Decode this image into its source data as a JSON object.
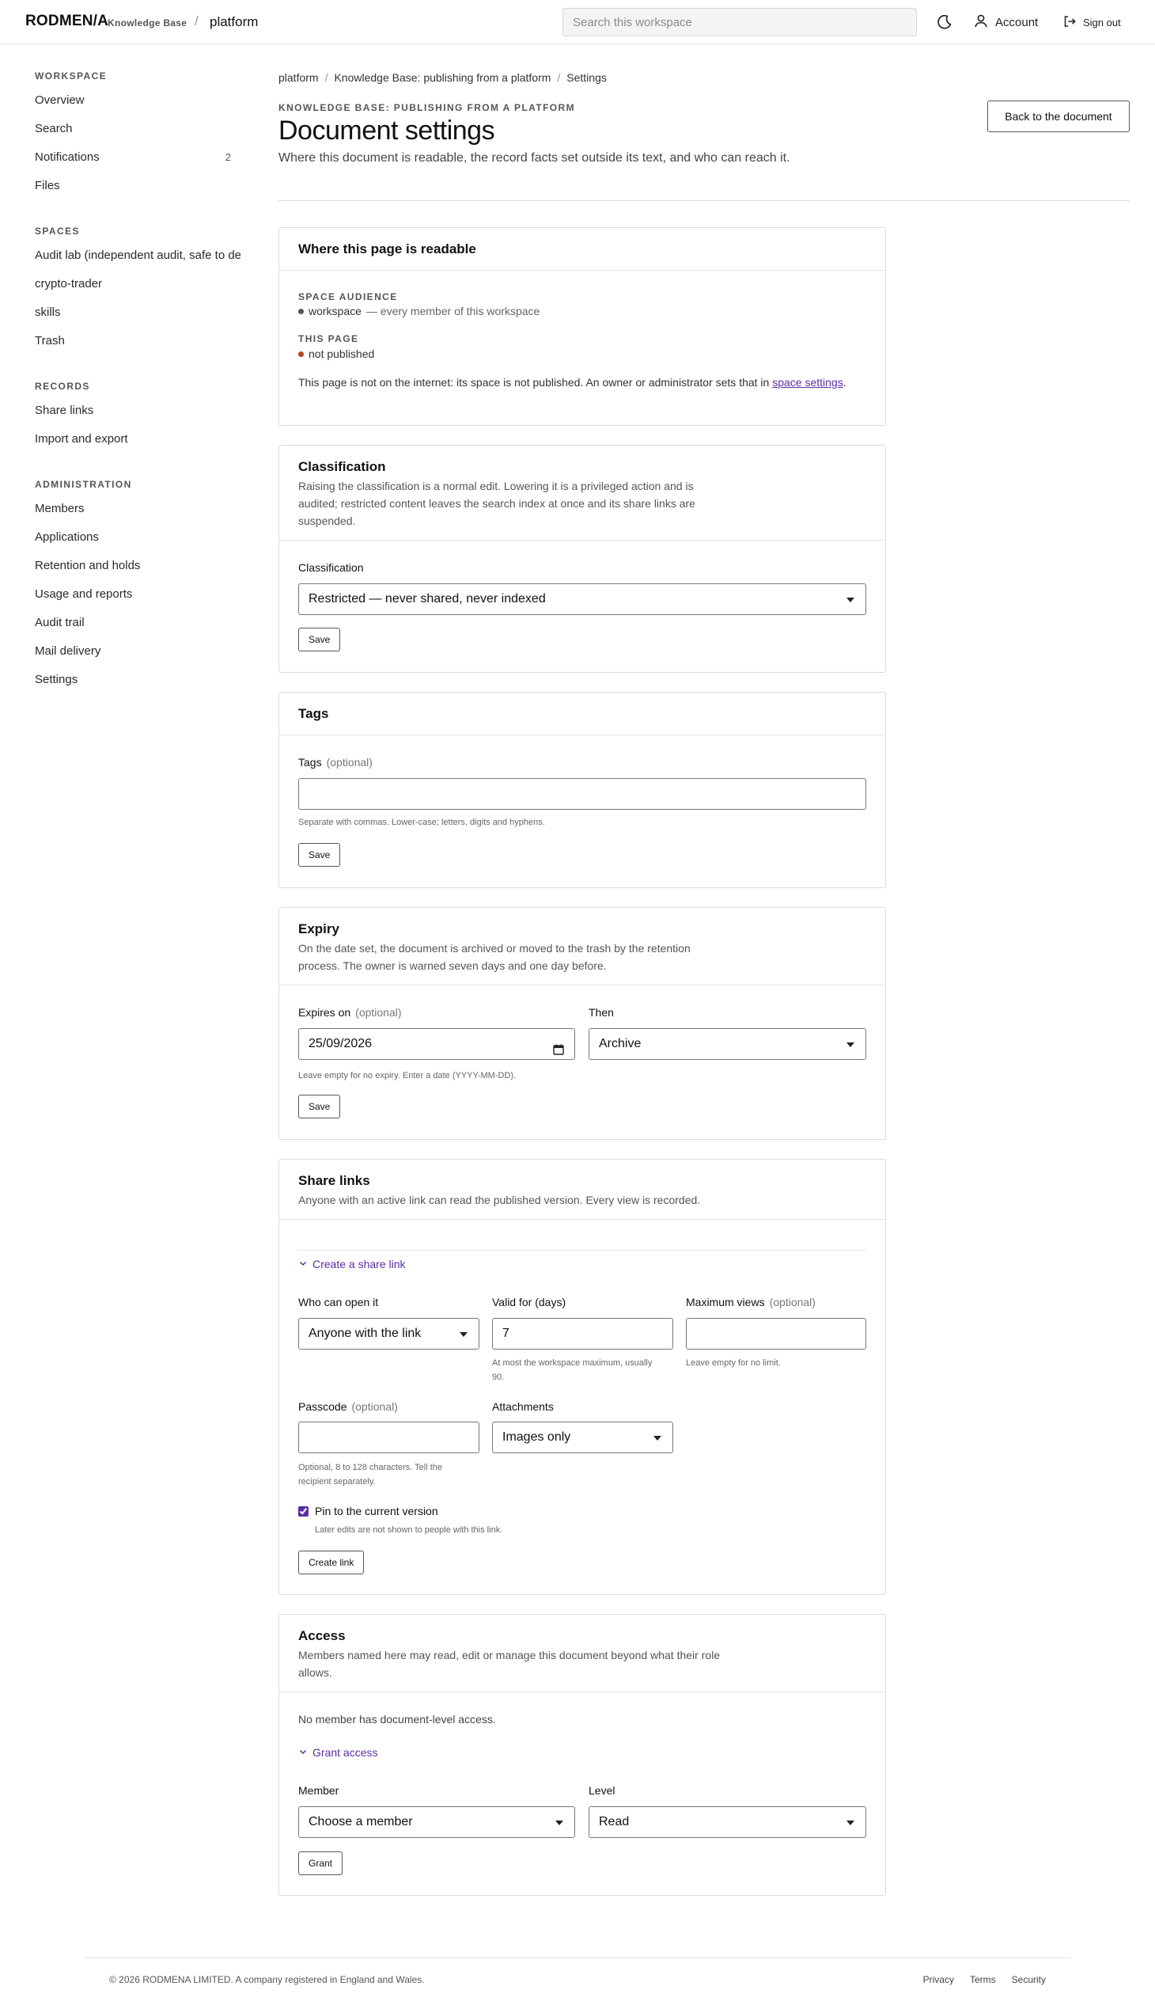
{
  "brand": {
    "name": "RODMEN/A",
    "product": "Knowledge Base",
    "separator": "/",
    "workspace": "platform"
  },
  "topbar": {
    "search_placeholder": "Search this workspace",
    "account_label": "Account",
    "signout_label": "Sign out",
    "icons": [
      "moon-icon",
      "user-icon",
      "sign-out-icon"
    ]
  },
  "sidebar": {
    "groups": [
      {
        "heading": "WORKSPACE",
        "items": [
          {
            "label": "Overview"
          },
          {
            "label": "Search"
          },
          {
            "label": "Notifications",
            "count": "2"
          },
          {
            "label": "Files"
          }
        ]
      },
      {
        "heading": "SPACES",
        "items": [
          {
            "label": "Audit lab (independent audit, safe to de"
          },
          {
            "label": "crypto-trader"
          },
          {
            "label": "skills"
          },
          {
            "label": "Trash"
          }
        ]
      },
      {
        "heading": "RECORDS",
        "items": [
          {
            "label": "Share links"
          },
          {
            "label": "Import and export"
          }
        ]
      },
      {
        "heading": "ADMINISTRATION",
        "items": [
          {
            "label": "Members"
          },
          {
            "label": "Applications"
          },
          {
            "label": "Retention and holds"
          },
          {
            "label": "Usage and reports"
          },
          {
            "label": "Audit trail"
          },
          {
            "label": "Mail delivery"
          },
          {
            "label": "Settings"
          }
        ]
      }
    ]
  },
  "breadcrumb": {
    "items": [
      "platform",
      "Knowledge Base: publishing from a platform",
      "Settings"
    ],
    "separator": "/"
  },
  "header": {
    "eyebrow": "KNOWLEDGE BASE: PUBLISHING FROM A PLATFORM",
    "title": "Document settings",
    "lede": "Where this document is readable, the record facts set outside its text, and who can reach it.",
    "back_button": "Back to the document"
  },
  "readable": {
    "title": "Where this page is readable",
    "audience_heading": "SPACE AUDIENCE",
    "audience_value": "workspace",
    "audience_note": "— every member of this workspace",
    "audience_dot_color": "#555555",
    "page_heading": "THIS PAGE",
    "page_value": "not published",
    "page_dot_color": "#b5421f",
    "note_text": "This page is not on the internet: its space is not published. An owner or administrator sets that in",
    "note_link": "space settings",
    "note_end": "."
  },
  "classification": {
    "title": "Classification",
    "desc": "Raising the classification is a normal edit. Lowering it is a privileged action and is audited; restricted content leaves the search index at once and its share links are suspended.",
    "label": "Classification",
    "selected": "Restricted — never shared, never indexed",
    "save": "Save"
  },
  "tags": {
    "title": "Tags",
    "label": "Tags",
    "optional": "(optional)",
    "value": "",
    "hint": "Separate with commas. Lower-case; letters, digits and hyphens.",
    "save": "Save"
  },
  "expiry": {
    "title": "Expiry",
    "desc": "On the date set, the document is archived or moved to the trash by the retention process. The owner is warned seven days and one day before.",
    "date_label": "Expires on",
    "optional": "(optional)",
    "date_value": "25/09/2026",
    "then_label": "Then",
    "then_selected": "Archive",
    "hint": "Leave empty for no expiry. Enter a date (YYYY-MM-DD).",
    "save": "Save"
  },
  "share": {
    "title": "Share links",
    "desc": "Anyone with an active link can read the published version. Every view is recorded.",
    "create_toggle": "Create a share link",
    "who_label": "Who can open it",
    "who_selected": "Anyone with the link",
    "valid_label": "Valid for (days)",
    "valid_value": "7",
    "valid_hint": "At most the workspace maximum, usually 90.",
    "maxviews_label": "Maximum views",
    "optional": "(optional)",
    "maxviews_value": "",
    "maxviews_hint": "Leave empty for no limit.",
    "passcode_label": "Passcode",
    "passcode_value": "",
    "passcode_hint": "Optional, 8 to 128 characters. Tell the recipient separately.",
    "attachments_label": "Attachments",
    "attachments_selected": "Images only",
    "pin_label": "Pin to the current version",
    "pin_checked": true,
    "pin_hint": "Later edits are not shown to people with this link.",
    "create_button": "Create link"
  },
  "access": {
    "title": "Access",
    "desc": "Members named here may read, edit or manage this document beyond what their role allows.",
    "empty": "No member has document-level access.",
    "grant_toggle": "Grant access",
    "member_label": "Member",
    "member_selected": "Choose a member",
    "level_label": "Level",
    "level_selected": "Read",
    "grant_button": "Grant"
  },
  "footer": {
    "text": "© 2026 RODMENA LIMITED. A company registered in England and Wales.",
    "links": [
      "Privacy",
      "Terms",
      "Security"
    ]
  },
  "colors": {
    "accent": "#5a2ea6",
    "border": "#dcdcdc"
  }
}
